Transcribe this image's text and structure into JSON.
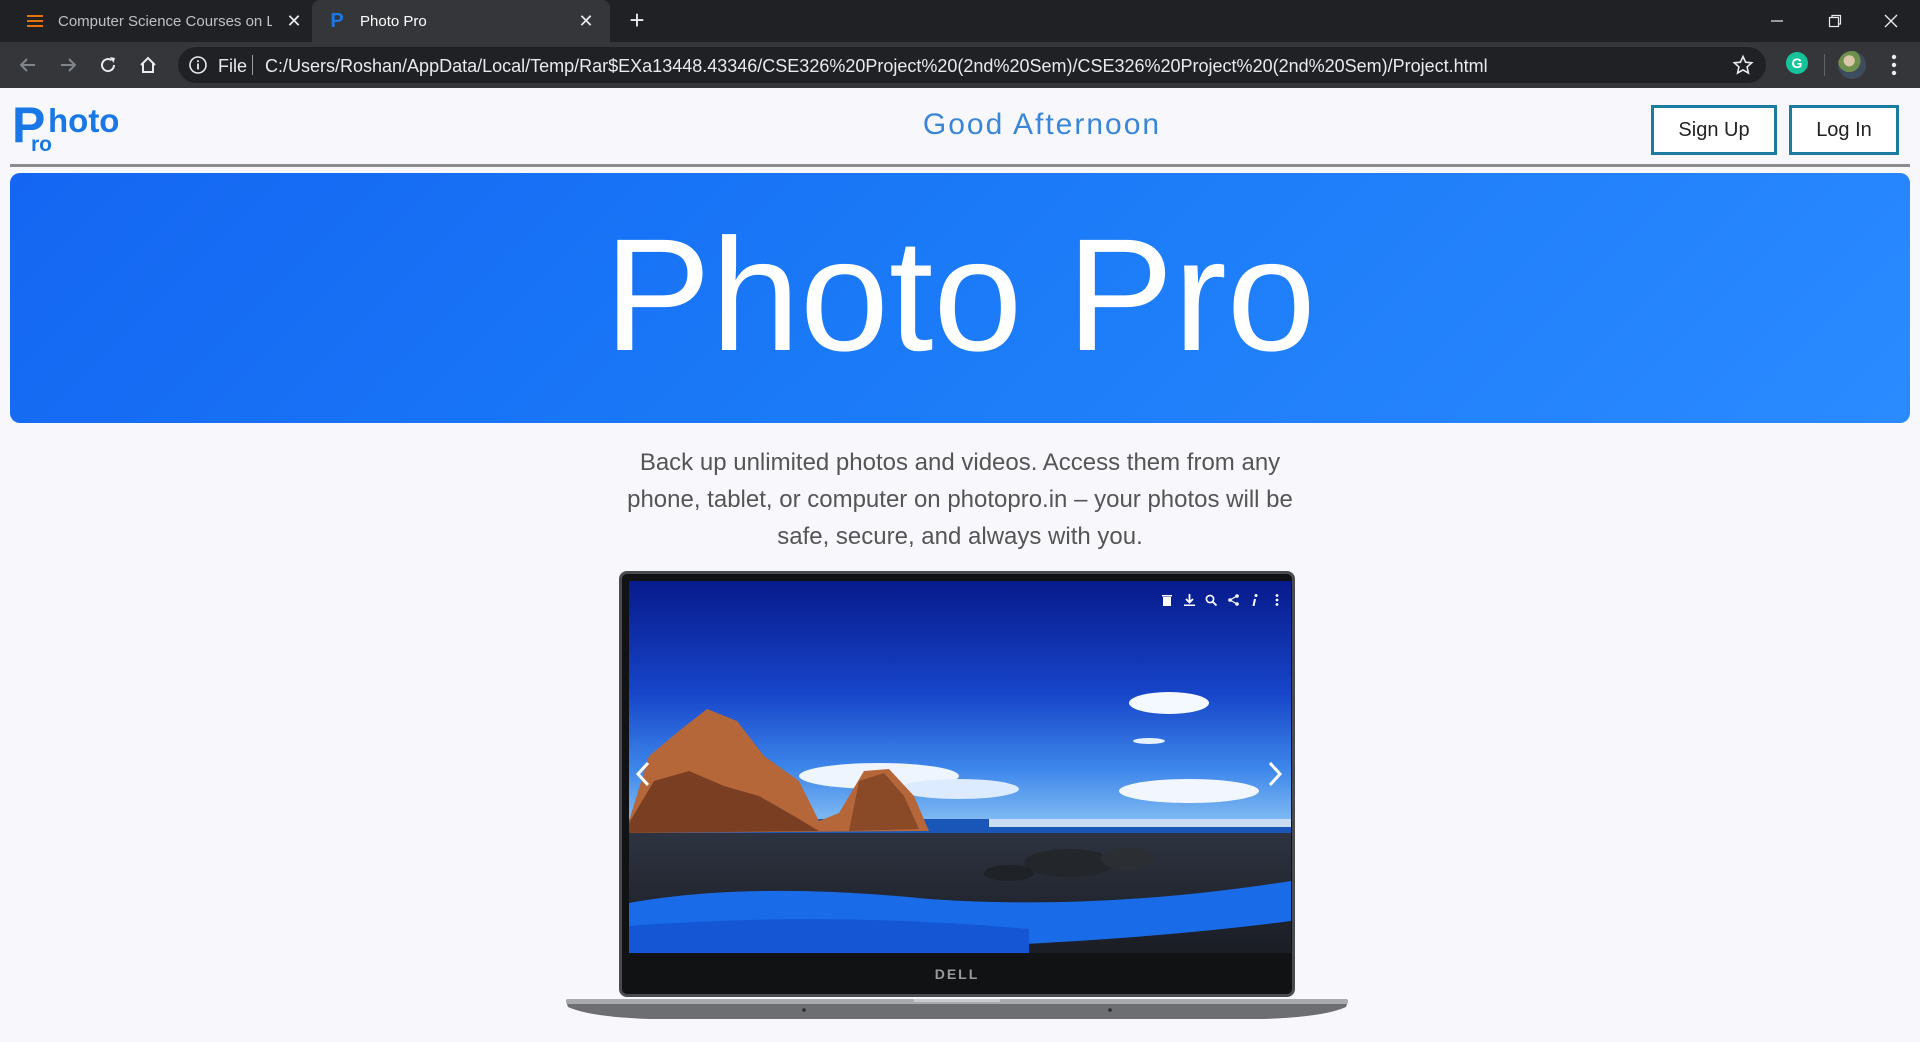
{
  "browser": {
    "tabs": [
      {
        "title": "Computer Science Courses on Le",
        "active": false,
        "favicon": "stacked-lines-icon"
      },
      {
        "title": "Photo Pro",
        "active": true,
        "favicon": "p-letter-icon"
      }
    ],
    "address": {
      "scheme_label": "File",
      "url": "C:/Users/Roshan/AppData/Local/Temp/Rar$EXa13448.43346/CSE326%20Project%20(2nd%20Sem)/CSE326%20Project%20(2nd%20Sem)/Project.html"
    },
    "extension_badge": "G"
  },
  "header": {
    "logo": {
      "big_letter": "P",
      "hoto": "hoto",
      "ro": "ro"
    },
    "greeting": "Good Afternoon",
    "signup_label": "Sign Up",
    "login_label": "Log In"
  },
  "hero": {
    "title": "Photo Pro"
  },
  "blurb": "Back up unlimited photos and videos. Access them from any phone, tablet, or computer on photopro.in – your photos will be safe, secure, and always with you.",
  "laptop": {
    "brand": "DELL"
  },
  "colors": {
    "accent": "#1a78e6",
    "hero": "#1a79f7",
    "button_border": "#1b7c9e"
  }
}
